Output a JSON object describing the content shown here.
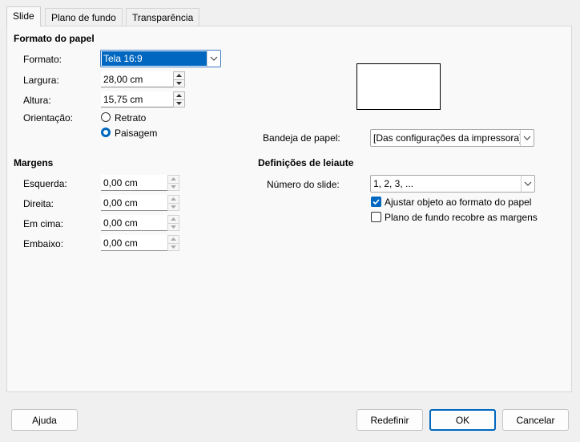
{
  "tabs": [
    {
      "label": "Slide",
      "active": true
    },
    {
      "label": "Plano de fundo",
      "active": false
    },
    {
      "label": "Transparência",
      "active": false
    }
  ],
  "paper_format": {
    "heading": "Formato do papel",
    "format_label": "Formato:",
    "format_value": "Tela 16:9",
    "width_label": "Largura:",
    "width_value": "28,00 cm",
    "height_label": "Altura:",
    "height_value": "15,75 cm",
    "orientation_label": "Orientação:",
    "orientation_options": [
      "Retrato",
      "Paisagem"
    ],
    "orientation_selected": "Paisagem",
    "paper_tray_label": "Bandeja de papel:",
    "paper_tray_value": "[Das configurações da impressora]"
  },
  "margins": {
    "heading": "Margens",
    "left_label": "Esquerda:",
    "left_value": "0,00 cm",
    "right_label": "Direita:",
    "right_value": "0,00 cm",
    "top_label": "Em cima:",
    "top_value": "0,00 cm",
    "bottom_label": "Embaixo:",
    "bottom_value": "0,00 cm"
  },
  "layout_settings": {
    "heading": "Definições de leiaute",
    "slide_number_label": "Número do slide:",
    "slide_number_value": "1, 2, 3, ...",
    "fit_object_label": "Ajustar objeto ao formato do papel",
    "fit_object_checked": true,
    "background_covers_label": "Plano de fundo recobre as margens",
    "background_covers_checked": false
  },
  "buttons": {
    "help": "Ajuda",
    "reset": "Redefinir",
    "ok": "OK",
    "cancel": "Cancelar"
  },
  "colors": {
    "accent": "#0067c0",
    "window_bg": "#f0f0f0",
    "panel_bg": "#f9f9f9"
  }
}
